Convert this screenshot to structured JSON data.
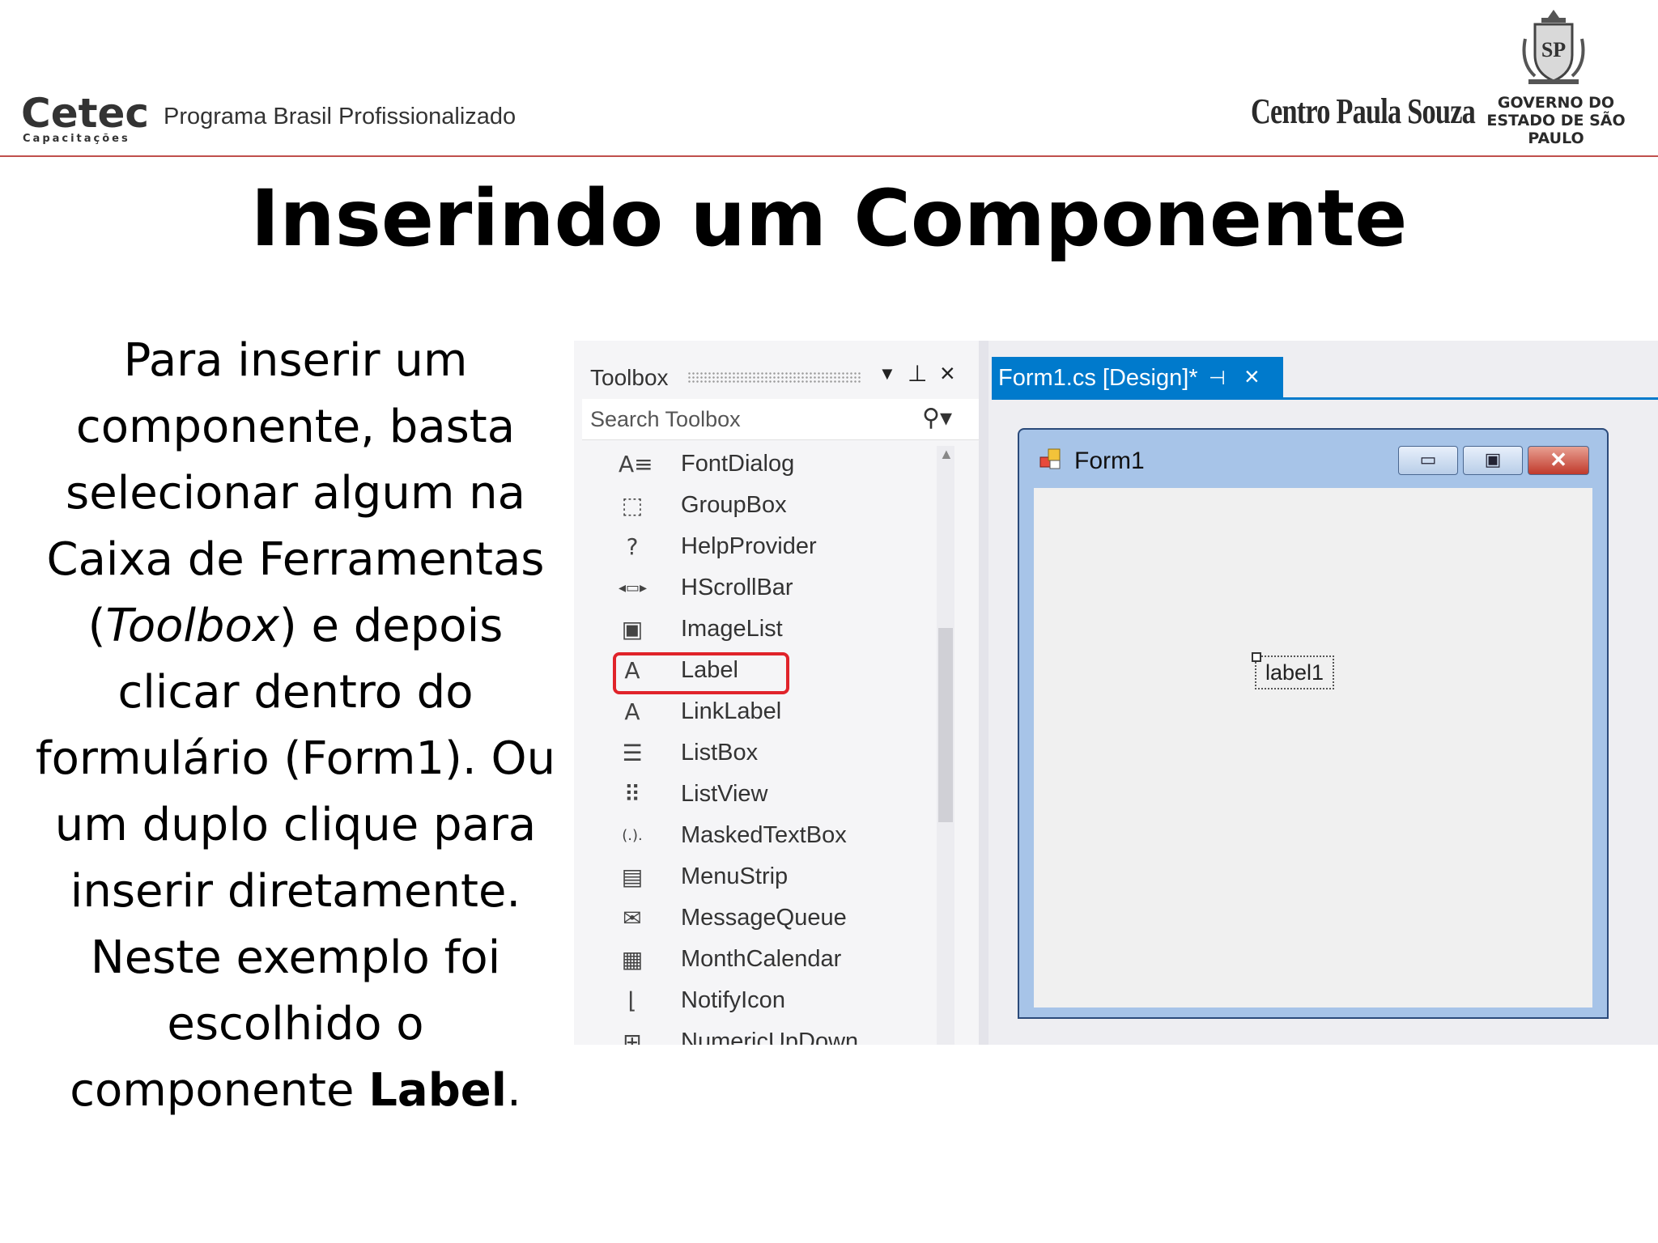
{
  "header": {
    "cetec_logo": "Cetec",
    "cetec_sub": "Capacitações",
    "program": "Programa Brasil Profissionalizado",
    "cps_logo": "Centro Paula Souza",
    "government": "GOVERNO DO ESTADO DE SÃO PAULO",
    "seal_text": "SP"
  },
  "title": "Inserindo um Componente",
  "body": {
    "part1": "Para inserir um componente, basta selecionar algum na Caixa de Ferramentas (",
    "toolbox_italic": "Toolbox",
    "part2": ") e depois clicar dentro do formulário (Form1). Ou um duplo clique para inserir diretamente. Neste exemplo foi escolhido o componente ",
    "label_bold": "Label",
    "part3": "."
  },
  "toolbox": {
    "title": "Toolbox",
    "search_placeholder": "Search Toolbox",
    "items": [
      {
        "label": "FontDialog",
        "icon": "font-dialog-icon",
        "glyph": "A≡"
      },
      {
        "label": "GroupBox",
        "icon": "groupbox-icon",
        "glyph": "⬚"
      },
      {
        "label": "HelpProvider",
        "icon": "help-provider-icon",
        "glyph": "?"
      },
      {
        "label": "HScrollBar",
        "icon": "hscrollbar-icon",
        "glyph": "◂▭▸"
      },
      {
        "label": "ImageList",
        "icon": "imagelist-icon",
        "glyph": "▣"
      },
      {
        "label": "Label",
        "icon": "label-icon",
        "glyph": "A"
      },
      {
        "label": "LinkLabel",
        "icon": "linklabel-icon",
        "glyph": "A"
      },
      {
        "label": "ListBox",
        "icon": "listbox-icon",
        "glyph": "☰"
      },
      {
        "label": "ListView",
        "icon": "listview-icon",
        "glyph": "⠿"
      },
      {
        "label": "MaskedTextBox",
        "icon": "maskedtextbox-icon",
        "glyph": "(.)."
      },
      {
        "label": "MenuStrip",
        "icon": "menustrip-icon",
        "glyph": "▤"
      },
      {
        "label": "MessageQueue",
        "icon": "messagequeue-icon",
        "glyph": "✉"
      },
      {
        "label": "MonthCalendar",
        "icon": "monthcalendar-icon",
        "glyph": "▦"
      },
      {
        "label": "NotifyIcon",
        "icon": "notifyicon-icon",
        "glyph": "⌊"
      },
      {
        "label": "NumericUpDown",
        "icon": "numericupdown-icon",
        "glyph": "⊞"
      }
    ]
  },
  "designer": {
    "tab_label": "Form1.cs [Design]*",
    "form_title": "Form1",
    "label_control": "label1"
  },
  "colors": {
    "accent": "#007acc",
    "highlight": "#e0232a",
    "header_rule": "#c0504d"
  }
}
